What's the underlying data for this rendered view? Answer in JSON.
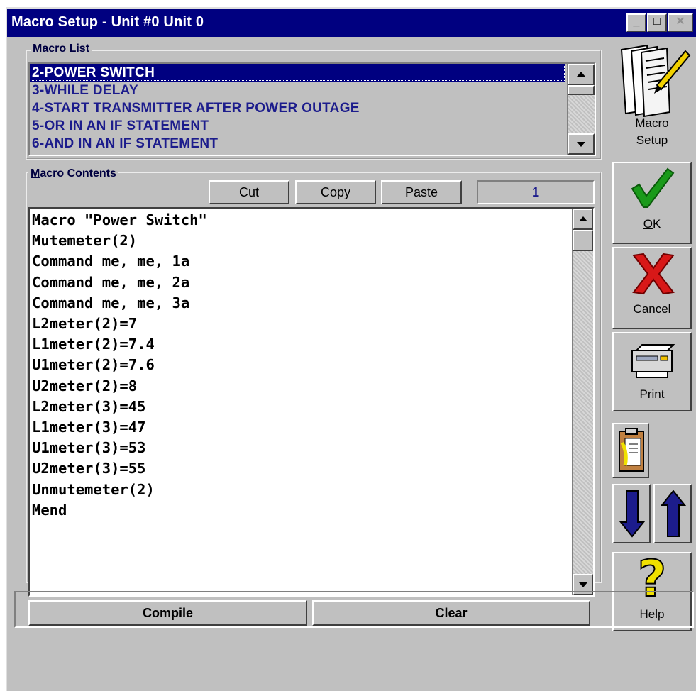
{
  "window": {
    "title": "Macro Setup - Unit #0 Unit 0",
    "controls": {
      "minimize": "_",
      "maximize": "□",
      "close": "✕"
    }
  },
  "macro_list": {
    "label": "Macro List",
    "items": [
      "2-POWER SWITCH",
      "3-WHILE DELAY",
      "4-START TRANSMITTER AFTER POWER OUTAGE",
      "5-OR IN AN IF STATEMENT",
      "6-AND IN AN IF STATEMENT"
    ],
    "selected_index": 0
  },
  "macro_contents": {
    "label_first": "M",
    "label_rest": "acro Contents",
    "cut_label": "Cut",
    "copy_label": "Copy",
    "paste_label": "Paste",
    "line_number": "1",
    "lines": [
      "Macro \"Power Switch\"",
      "Mutemeter(2)",
      "Command me, me, 1a",
      "Command me, me, 2a",
      "Command me, me, 3a",
      "L2meter(2)=7",
      "L1meter(2)=7.4",
      "U1meter(2)=7.6",
      "U2meter(2)=8",
      "L2meter(3)=45",
      "L1meter(3)=47",
      "U1meter(3)=53",
      "U2meter(3)=55",
      "Unmutemeter(2)",
      "Mend"
    ],
    "compile_label": "Compile",
    "clear_label": "Clear"
  },
  "sidebar": {
    "macro_setup_line1": "Macro",
    "macro_setup_line2": "Setup",
    "ok_first": "O",
    "ok_rest": "K",
    "cancel_first": "C",
    "cancel_rest": "ancel",
    "print_first": "P",
    "print_rest": "rint",
    "help_first": "H",
    "help_rest": "elp",
    "help_glyph": "?",
    "icons": {
      "ok": "checkmark-icon",
      "cancel": "x-icon",
      "print": "printer-icon",
      "clipboard": "clipboard-icon",
      "down": "down-arrow-icon",
      "up": "up-arrow-icon",
      "help": "question-mark-icon",
      "macro_setup": "macro-setup-icon"
    }
  },
  "colors": {
    "title_bar": "#000080",
    "face": "#c0c0c0",
    "list_text": "#1c1c8c",
    "ok_green": "#1a9a1a",
    "cancel_red": "#d81818",
    "arrow_blue": "#1c1c8c",
    "help_yellow": "#f0e000"
  },
  "status_bar": {
    "text": ""
  }
}
